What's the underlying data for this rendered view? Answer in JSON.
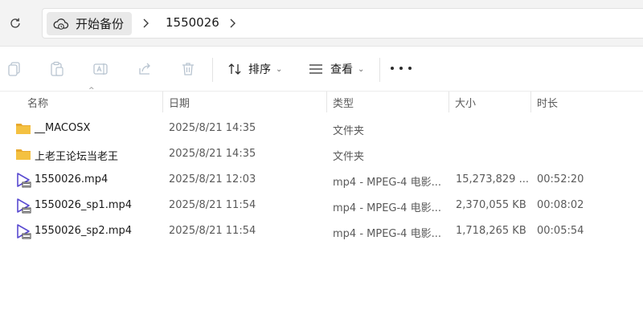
{
  "address": {
    "home_label": "开始备份",
    "folder_label": "1550026"
  },
  "toolbar": {
    "sort_label": "排序",
    "view_label": "查看"
  },
  "columns": {
    "name": "名称",
    "date": "日期",
    "type": "类型",
    "size": "大小",
    "duration": "时长"
  },
  "rows": [
    {
      "icon": "folder-icon",
      "name": "__MACOSX",
      "date": "2025/8/21 14:35",
      "type": "文件夹",
      "size": "",
      "duration": ""
    },
    {
      "icon": "folder-icon",
      "name": "上老王论坛当老王",
      "date": "2025/8/21 14:35",
      "type": "文件夹",
      "size": "",
      "duration": ""
    },
    {
      "icon": "video-file-icon",
      "name": "1550026.mp4",
      "date": "2025/8/21 12:03",
      "type": "mp4 - MPEG-4 电影...",
      "size": "15,273,829 ...",
      "duration": "00:52:20"
    },
    {
      "icon": "video-file-icon",
      "name": "1550026_sp1.mp4",
      "date": "2025/8/21 11:54",
      "type": "mp4 - MPEG-4 电影...",
      "size": "2,370,055 KB",
      "duration": "00:08:02"
    },
    {
      "icon": "video-file-icon",
      "name": "1550026_sp2.mp4",
      "date": "2025/8/21 11:54",
      "type": "mp4 - MPEG-4 电影...",
      "size": "1,718,265 KB",
      "duration": "00:05:54"
    }
  ],
  "colors": {
    "folder": "#f4c141",
    "video_icon": "#5a4bd1",
    "icon_disabled": "#b8c4d0"
  }
}
